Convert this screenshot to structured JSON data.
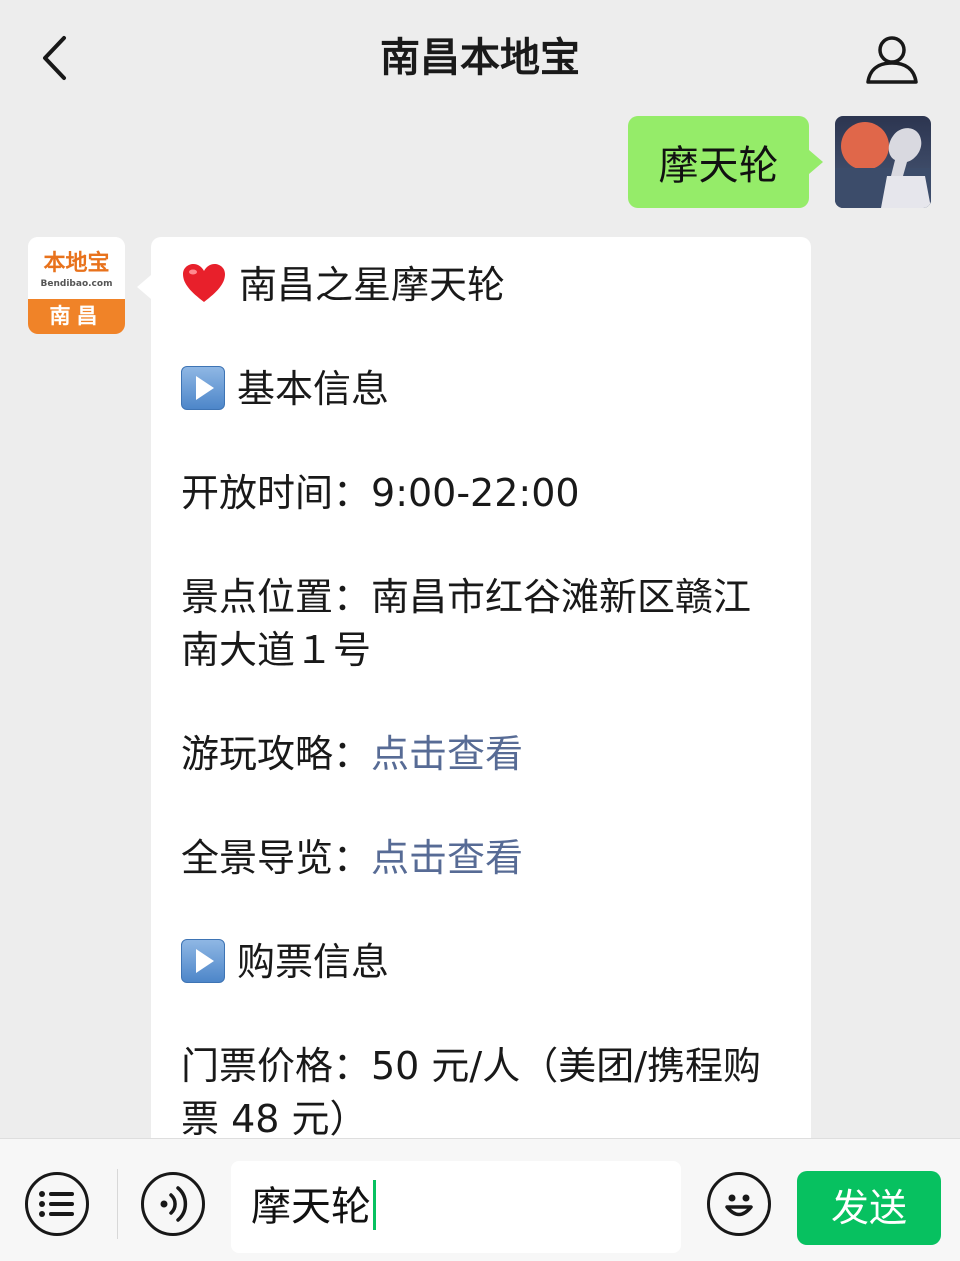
{
  "header": {
    "title": "南昌本地宝",
    "back_icon": "chevron-left-icon",
    "profile_icon": "person-icon"
  },
  "messages": {
    "sent": {
      "text": "摩天轮"
    },
    "bot": {
      "avatar_brand": "本地宝",
      "avatar_url": "Bendibao.com",
      "avatar_city": "南昌",
      "title": "南昌之星摩天轮",
      "basic_heading": "基本信息",
      "open_label": "开放时间：",
      "open_value": "9:00-22:00",
      "location_label": "景点位置：",
      "location_value_1": "南昌市红谷滩新区赣江",
      "location_value_2": "南大道１号",
      "guide_label": "游玩攻略：",
      "guide_link": "点击查看",
      "panorama_label": "全景导览：",
      "panorama_link": "点击查看",
      "ticket_heading": "购票信息",
      "price_line_1": "门票价格：50 元/人（美团/携程购",
      "price_line_2": "票 48 元）"
    }
  },
  "input_bar": {
    "menu_icon": "list-menu-icon",
    "voice_icon": "voice-icon",
    "input_value": "摩天轮",
    "emoji_icon": "emoji-icon",
    "send_label": "发送"
  },
  "colors": {
    "background": "#ededed",
    "sent_bubble": "#95ec69",
    "link": "#576b95",
    "send_button": "#07c160",
    "brand_orange": "#f08328"
  }
}
